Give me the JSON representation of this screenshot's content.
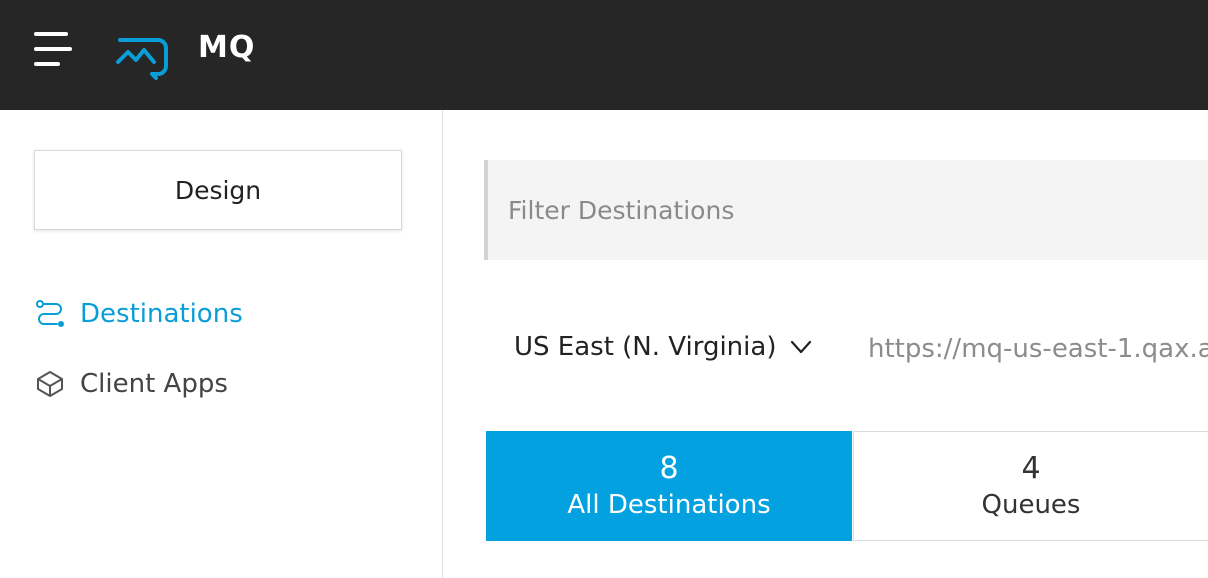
{
  "header": {
    "app_name": "MQ",
    "menu_icon": "hamburger-menu-icon",
    "logo_icon": "mq-logo-icon",
    "background": "#262626",
    "logo_color": "#0a9ed8"
  },
  "sidebar": {
    "design_button": "Design",
    "items": [
      {
        "label": "Destinations",
        "icon": "destinations-route-icon",
        "active": true
      },
      {
        "label": "Client Apps",
        "icon": "client-apps-cube-icon",
        "active": false
      }
    ],
    "active_color": "#0a9ed8"
  },
  "main": {
    "filter": {
      "placeholder": "Filter Destinations",
      "value": ""
    },
    "region": {
      "label": "US East (N. Virginia)",
      "icon": "chevron-down-icon"
    },
    "region_url": "https://mq-us-east-1.qax.a",
    "tabs": [
      {
        "count": "8",
        "label": "All Destinations",
        "selected": true
      },
      {
        "count": "4",
        "label": "Queues",
        "selected": false
      }
    ],
    "accent": "#04a1e0"
  }
}
